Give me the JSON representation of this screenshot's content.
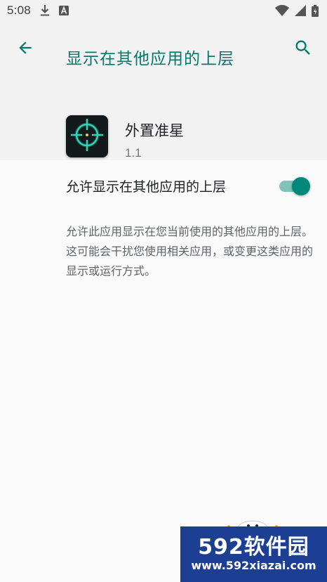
{
  "status_bar": {
    "time": "5:08",
    "icons": [
      "download-icon",
      "font-a-icon",
      "wifi-icon",
      "signal-icon",
      "battery-icon"
    ]
  },
  "toolbar": {
    "title": "显示在其他应用的上层",
    "back_icon": "arrow-back-icon",
    "search_icon": "search-icon",
    "accent_color": "#00796b"
  },
  "app": {
    "name": "外置准星",
    "version": "1.1",
    "icon": "crosshair-icon"
  },
  "permission": {
    "label": "允许显示在其他应用的上层",
    "enabled": true,
    "toggle_color": "#00897b",
    "description": "允许此应用显示在您当前使用的其他应用的上层。这可能会干扰您使用相关应用，或变更这类应用的显示或运行方式。"
  },
  "watermark": {
    "brand": "592软件园",
    "url": "www.592xiazai.com"
  }
}
